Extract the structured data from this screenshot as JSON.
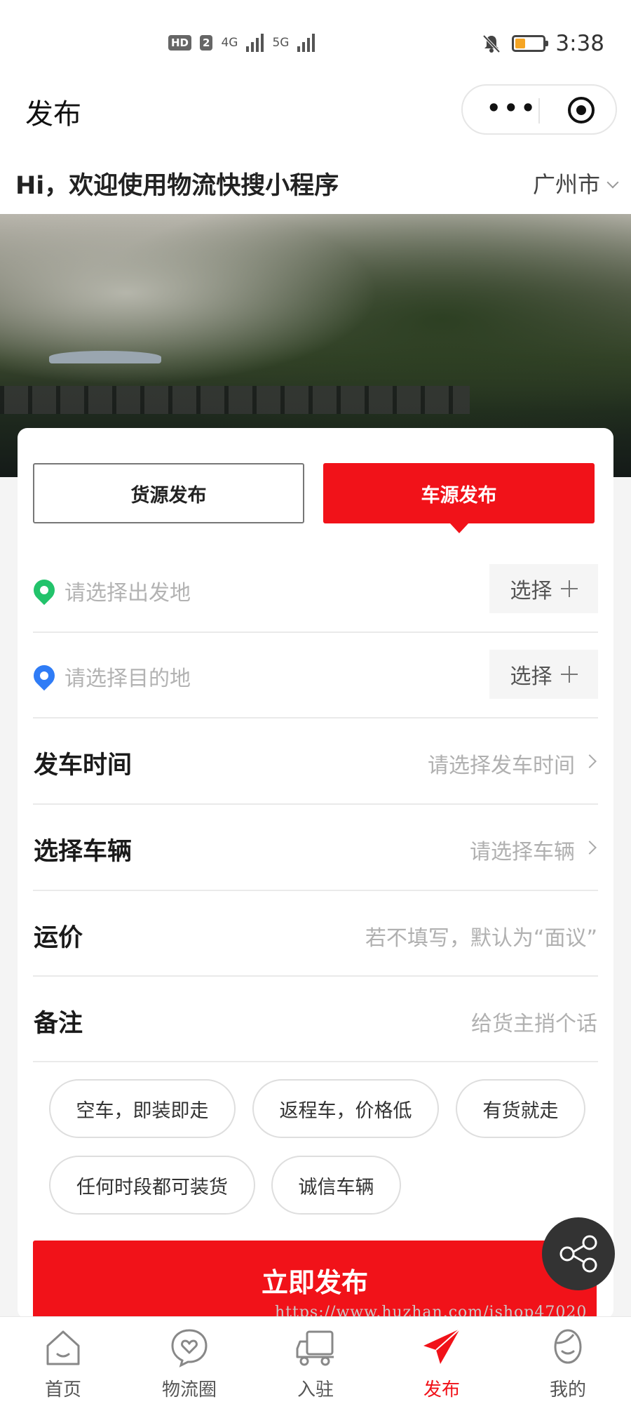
{
  "status_bar": {
    "hd_label": "HD",
    "sim_label": "2",
    "net1": "4G",
    "net2": "5G",
    "time": "3:38",
    "battery_level": 0.35,
    "icons": [
      "signal-icon",
      "mute-bell-icon",
      "battery-icon"
    ]
  },
  "nav": {
    "title": "发布",
    "capsule_more": "•••"
  },
  "header": {
    "greeting": "Hi，欢迎使用物流快搜小程序",
    "city": "广州市"
  },
  "tabs": {
    "goods": "货源发布",
    "vehicle": "车源发布",
    "active": "vehicle"
  },
  "locations": {
    "origin_placeholder": "请选择出发地",
    "destination_placeholder": "请选择目的地",
    "select_label": "选择",
    "origin_color": "#22c36b",
    "destination_color": "#2f7cf6"
  },
  "fields": {
    "depart_time": {
      "label": "发车时间",
      "placeholder": "请选择发车时间"
    },
    "vehicle": {
      "label": "选择车辆",
      "placeholder": "请选择车辆"
    },
    "price": {
      "label": "运价",
      "placeholder": "若不填写，默认为“面议”"
    },
    "remark": {
      "label": "备注",
      "placeholder": "给货主捎个话"
    }
  },
  "tags": [
    "空车，即装即走",
    "返程车，价格低",
    "有货就走",
    "任何时段都可装货",
    "诚信车辆"
  ],
  "actions": {
    "publish": "立即发布"
  },
  "watermark": "https://www.huzhan.com/ishop47020",
  "tabbar": {
    "items": [
      {
        "label": "首页",
        "icon": "home-icon"
      },
      {
        "label": "物流圈",
        "icon": "heart-chat-icon"
      },
      {
        "label": "入驻",
        "icon": "truck-icon"
      },
      {
        "label": "发布",
        "icon": "paper-plane-icon"
      },
      {
        "label": "我的",
        "icon": "profile-icon"
      }
    ],
    "active_index": 3
  },
  "colors": {
    "accent": "#f11219",
    "text": "#222222",
    "placeholder": "#b0b0b0"
  }
}
